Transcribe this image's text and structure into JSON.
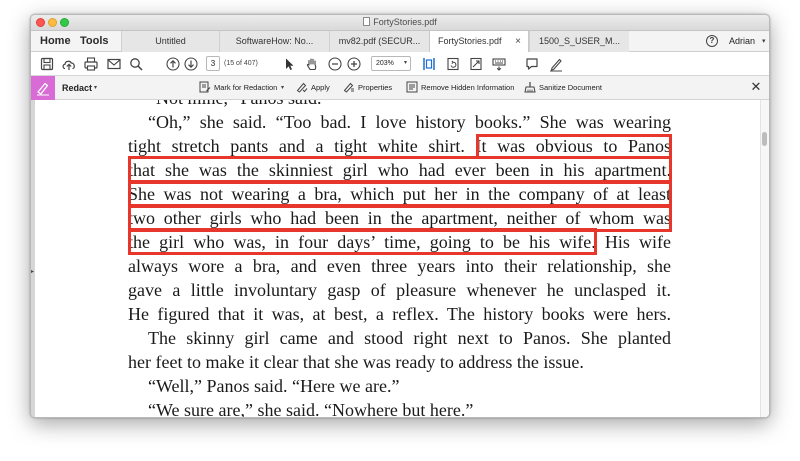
{
  "window": {
    "title": "FortyStories.pdf"
  },
  "nav": {
    "home": "Home",
    "tools": "Tools"
  },
  "tabs": [
    {
      "label": "Untitled",
      "active": false
    },
    {
      "label": "SoftwareHow: No...",
      "active": false
    },
    {
      "label": "mv82.pdf (SECUR...",
      "active": false
    },
    {
      "label": "FortyStories.pdf",
      "active": true
    },
    {
      "label": "1500_S_USER_M...",
      "active": false
    }
  ],
  "tab_close_glyph": "×",
  "user": {
    "help": "?",
    "name": "Adrian",
    "caret": "▾"
  },
  "toolbar": {
    "icons": [
      "save-icon",
      "cloud-upload-icon",
      "print-icon",
      "email-icon",
      "search-icon",
      "page-up-icon",
      "page-down-icon",
      "select-arrow-icon",
      "hand-icon",
      "zoom-out-icon",
      "zoom-in-icon",
      "fit-page-icon",
      "rotate-icon",
      "crop-icon",
      "keyboard-icon",
      "comment-icon",
      "sign-icon"
    ],
    "page_number": "3",
    "page_of": "(15 of 407)",
    "zoom": "203%",
    "zoom_caret": "▾"
  },
  "redact_toolbar": {
    "label": "Redact",
    "label_caret": "▾",
    "mark": "Mark for Redaction",
    "mark_caret": "▾",
    "apply": "Apply",
    "properties": "Properties",
    "remove_hidden": "Remove Hidden Information",
    "sanitize": "Sanitize Document",
    "close": "✕"
  },
  "document": {
    "lines": [
      {
        "text": "“Not mine,” Panos said.",
        "indent": true,
        "justify": false
      },
      {
        "text": "“Oh,” she said. “Too bad. I love history books.” She was wearing",
        "indent": true,
        "justify": true
      },
      {
        "text": "tight stretch pants and a tight white shirt. It was obvious to Panos",
        "indent": false,
        "justify": true
      },
      {
        "text": "that she was the skinniest girl who had ever been in his apartment.",
        "indent": false,
        "justify": true
      },
      {
        "text": "She was not wearing a bra, which put her in the company of at least",
        "indent": false,
        "justify": true
      },
      {
        "text": "two other girls who had been in the apartment, neither of whom was",
        "indent": false,
        "justify": true
      },
      {
        "text": "the girl who was, in four days’ time, going to be his wife. His wife",
        "indent": false,
        "justify": true
      },
      {
        "text": "always wore a bra, and even three years into their relationship, she",
        "indent": false,
        "justify": true
      },
      {
        "text": "gave a little involuntary gasp of pleasure whenever he unclasped it.",
        "indent": false,
        "justify": true
      },
      {
        "text": "He figured that it was, at best, a reflex. The history books were hers.",
        "indent": false,
        "justify": true
      },
      {
        "text": "The skinny girl came and stood right next to Panos. She planted",
        "indent": true,
        "justify": true
      },
      {
        "text": "her feet to make it clear that she was ready to address the issue.",
        "indent": false,
        "justify": false
      },
      {
        "text": "“Well,” Panos said. “Here we are.”",
        "indent": true,
        "justify": false
      },
      {
        "text": "“We sure are,” she said. “Nowhere but here.”",
        "indent": true,
        "justify": false
      }
    ]
  },
  "colors": {
    "redact_accent": "#d96bd6",
    "redaction_mark": "#e7372c"
  }
}
